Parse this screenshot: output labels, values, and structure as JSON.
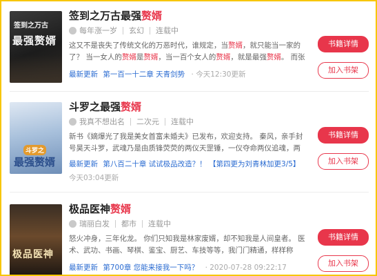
{
  "books": [
    {
      "title_prefix": "签到之万古最强",
      "title_keyword": "赘婿",
      "cover_text": "最强赘婿",
      "cover_top_text": "签到之万古",
      "author": "每年涨一岁",
      "genre": "玄幻",
      "status": "连载中",
      "desc_parts": [
        "这又不是丧失了传统文化的万恶时代，谁规定，当",
        "赘婿",
        "，就只能当一家的了？ 当一女人的",
        "赘婿",
        "是",
        "赘婿",
        "，当一百个女人的",
        "赘婿",
        "，就是最强",
        "赘婿",
        "。 而张阳，一个当了上百个女帝的"
      ],
      "latest_label": "最新更新",
      "latest_chapter": "第一百一十二章 天青剑势",
      "latest_time": "· 今天12:30更新",
      "btn_details": "书籍详情",
      "btn_shelf": "加入书架"
    },
    {
      "title_prefix": "斗罗之最强",
      "title_keyword": "赘婿",
      "cover_text": "最强赘婿",
      "cover_top_text": "斗罗之",
      "author": "我真不想出名",
      "genre": "二次元",
      "status": "连载中",
      "desc_parts": [
        "新书《嫡爆光了我是美女首富未婚夫》已发布，欢迎支持。 秦风，亲手封号昊天斗罗，武魂乃是由质锋荧荧的两仪天罡锤，一仪夺命两仪追魂，两仪天罡锤不但拥有超越昊天"
      ],
      "latest_label": "最新更新",
      "latest_chapter": "第八百二十章 试试极品改造？！",
      "latest_volume": "【第四更为刘青林加更3/5】",
      "latest_time": "今天03:04更新",
      "btn_details": "书籍详情",
      "btn_shelf": "加入书架"
    },
    {
      "title_prefix": "极品医神",
      "title_keyword": "赘婿",
      "cover_text": "极品医神",
      "author": "瑞丽白发",
      "genre": "都市",
      "status": "连载中",
      "desc_parts": [
        "怒火冲身，三年化龙。 你们只知我是林家废婿，却不知我是人间皇者。 医术、武功、书画、琴棋、鉴宝、厨艺、车技等等，我门门精通，样样称霸。"
      ],
      "latest_label": "最新更新",
      "latest_chapter": "第700章 您能来接我一下吗？",
      "latest_time": "· 2020-07-28 09:22:17",
      "btn_details": "书籍详情",
      "btn_shelf": "加入书架"
    }
  ],
  "colors": {
    "accent": "#e8364b",
    "link": "#2a6bd1",
    "border": "#f7c600"
  }
}
